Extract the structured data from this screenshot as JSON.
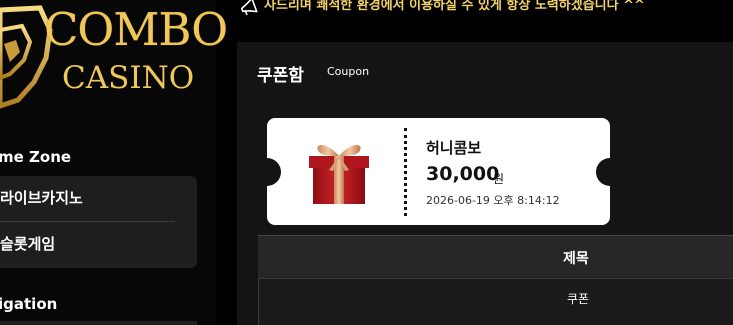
{
  "sidebar": {
    "logo": {
      "line1": "COMBO",
      "line2": "CASINO"
    },
    "game_zone_title": "me Zone",
    "menu": [
      {
        "label": "라이브카지노"
      },
      {
        "label": "슬롯게임"
      }
    ],
    "navigation_title": "igation"
  },
  "notice": {
    "text": "사드리며 쾌적한 환경에서 이용하실 수 있게 항상 노력하겠습니다 ^^",
    "icon": "megaphone-icon"
  },
  "coupon_panel": {
    "title": "쿠폰함",
    "subtitle": "Coupon",
    "coupon": {
      "name": "허니콤보",
      "amount": "30,000",
      "unit": "원",
      "date": "2026-06-19 오후 8:14:12",
      "icon": "gift-box-icon"
    },
    "table": {
      "header": "제목",
      "rows": [
        {
          "title": "쿠폰"
        }
      ]
    }
  },
  "colors": {
    "accent_gold": "#f0c75a",
    "notice_yellow": "#f4d36a",
    "panel_bg": "#141414"
  }
}
